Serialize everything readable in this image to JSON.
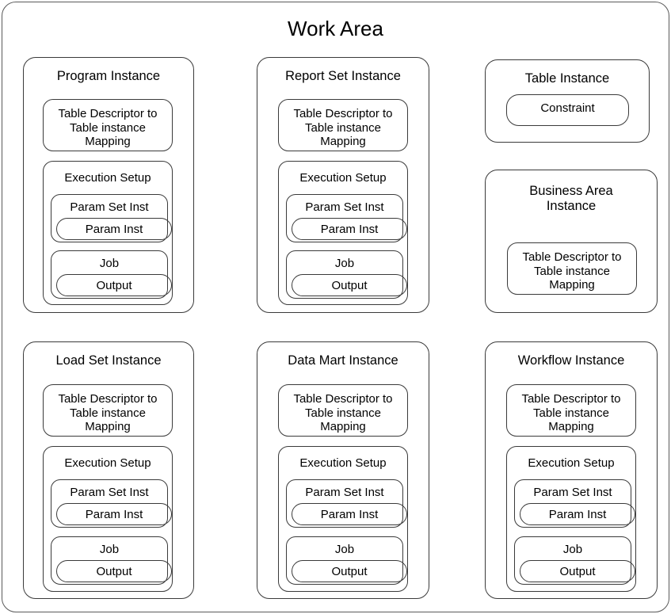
{
  "diagram": {
    "title": "Work Area",
    "shared": {
      "table_descriptor_mapping": "Table Descriptor to\nTable instance\nMapping",
      "execution_setup": "Execution Setup",
      "param_set_inst": "Param Set Inst",
      "param_inst": "Param Inst",
      "job": "Job",
      "output": "Output"
    },
    "nodes": {
      "program_instance": {
        "title": "Program Instance",
        "table_descriptor_mapping": "Table Descriptor to\nTable instance\nMapping",
        "execution_setup": "Execution Setup",
        "param_set_inst": "Param Set Inst",
        "param_inst": "Param Inst",
        "job": "Job",
        "output": "Output"
      },
      "report_set_instance": {
        "title": "Report Set Instance",
        "table_descriptor_mapping": "Table Descriptor to\nTable instance\nMapping",
        "execution_setup": "Execution Setup",
        "param_set_inst": "Param Set Inst",
        "param_inst": "Param Inst",
        "job": "Job",
        "output": "Output"
      },
      "table_instance": {
        "title": "Table Instance",
        "constraint": "Constraint"
      },
      "business_area_instance": {
        "title": "Business Area\nInstance",
        "table_descriptor_mapping": "Table Descriptor to\nTable instance\nMapping"
      },
      "load_set_instance": {
        "title": "Load Set Instance",
        "table_descriptor_mapping": "Table Descriptor to\nTable instance\nMapping",
        "execution_setup": "Execution Setup",
        "param_set_inst": "Param Set Inst",
        "param_inst": "Param Inst",
        "job": "Job",
        "output": "Output"
      },
      "data_mart_instance": {
        "title": "Data Mart Instance",
        "table_descriptor_mapping": "Table Descriptor to\nTable instance\nMapping",
        "execution_setup": "Execution Setup",
        "param_set_inst": "Param Set Inst",
        "param_inst": "Param Inst",
        "job": "Job",
        "output": "Output"
      },
      "workflow_instance": {
        "title": "Workflow Instance",
        "table_descriptor_mapping": "Table Descriptor to\nTable instance\nMapping",
        "execution_setup": "Execution Setup",
        "param_set_inst": "Param Set Inst",
        "param_inst": "Param Inst",
        "job": "Job",
        "output": "Output"
      }
    },
    "colors": {
      "background": "#ffffff",
      "border": "#3a3a3a",
      "frame_border": "#5a5a5a",
      "text": "#000000"
    }
  }
}
